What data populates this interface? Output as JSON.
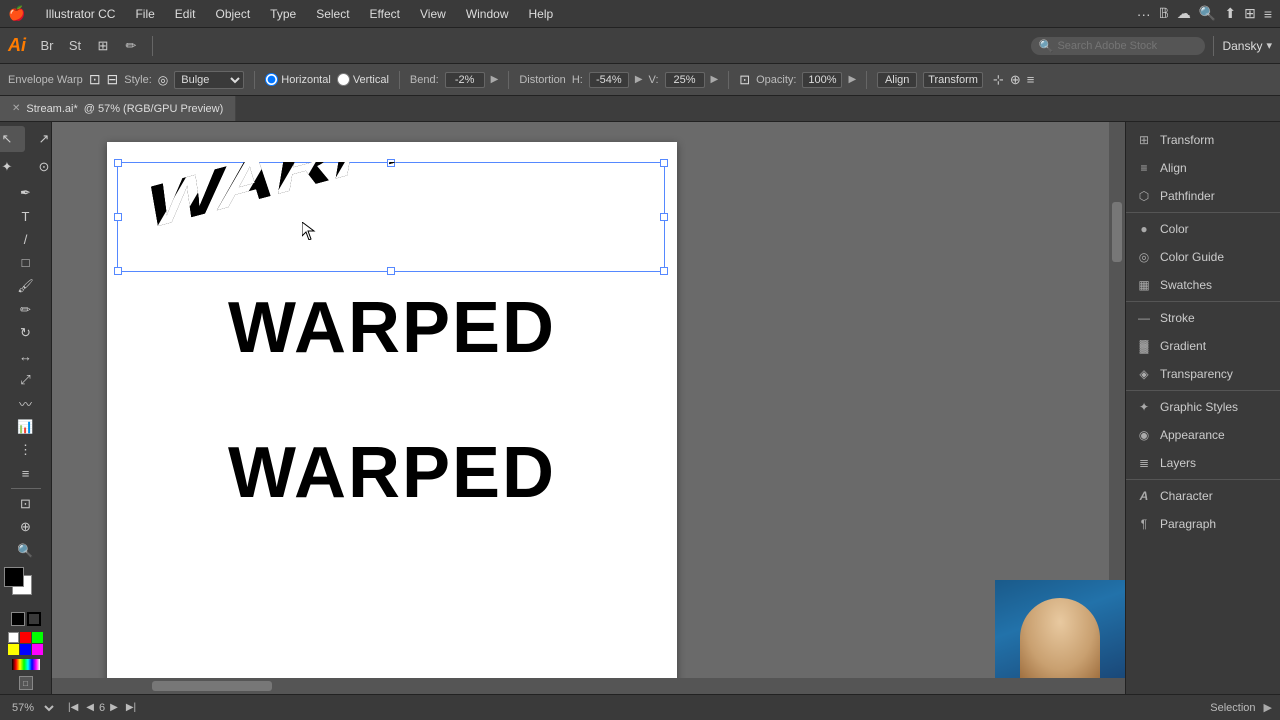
{
  "app": {
    "name": "Illustrator CC",
    "logo": "Ai"
  },
  "menubar": {
    "apple": "🍎",
    "items": [
      "Illustrator CC",
      "File",
      "Edit",
      "Object",
      "Type",
      "Select",
      "Effect",
      "View",
      "Window",
      "Help"
    ]
  },
  "toolbar": {
    "user": "Dansky",
    "search_placeholder": "Search Adobe Stock"
  },
  "options_bar": {
    "label": "Envelope Warp",
    "style_label": "Style:",
    "style_value": "Bulge",
    "horizontal_label": "Horizontal",
    "vertical_label": "Vertical",
    "bend_label": "Bend:",
    "bend_value": "-2%",
    "distortion_label": "Distortion",
    "h_label": "H:",
    "h_value": "-54%",
    "v_label": "V:",
    "v_value": "25%",
    "opacity_label": "Opacity:",
    "opacity_value": "100%",
    "align_label": "Align",
    "transform_label": "Transform"
  },
  "tab": {
    "filename": "Stream.ai*",
    "info": "@ 57% (RGB/GPU Preview)"
  },
  "canvas": {
    "zoom": "57%",
    "status": "Selection"
  },
  "warped_text": "WARPED",
  "text1": "WARPED",
  "text2": "WARPED",
  "right_panel": {
    "items": [
      {
        "icon": "⊞",
        "label": "Transform"
      },
      {
        "icon": "≡",
        "label": "Align"
      },
      {
        "icon": "⬡",
        "label": "Pathfinder"
      },
      {
        "icon": "●",
        "label": "Color"
      },
      {
        "icon": "◎",
        "label": "Color Guide"
      },
      {
        "icon": "▦",
        "label": "Swatches"
      },
      {
        "icon": "—",
        "label": "Stroke"
      },
      {
        "icon": "▓",
        "label": "Gradient"
      },
      {
        "icon": "◈",
        "label": "Transparency"
      },
      {
        "icon": "✦",
        "label": "Graphic Styles"
      },
      {
        "icon": "◉",
        "label": "Appearance"
      },
      {
        "icon": "≣",
        "label": "Layers"
      },
      {
        "icon": "A",
        "label": "Character"
      },
      {
        "icon": "¶",
        "label": "Paragraph"
      }
    ]
  },
  "status_bar": {
    "zoom": "57%",
    "page": "6",
    "mode": "Selection"
  }
}
